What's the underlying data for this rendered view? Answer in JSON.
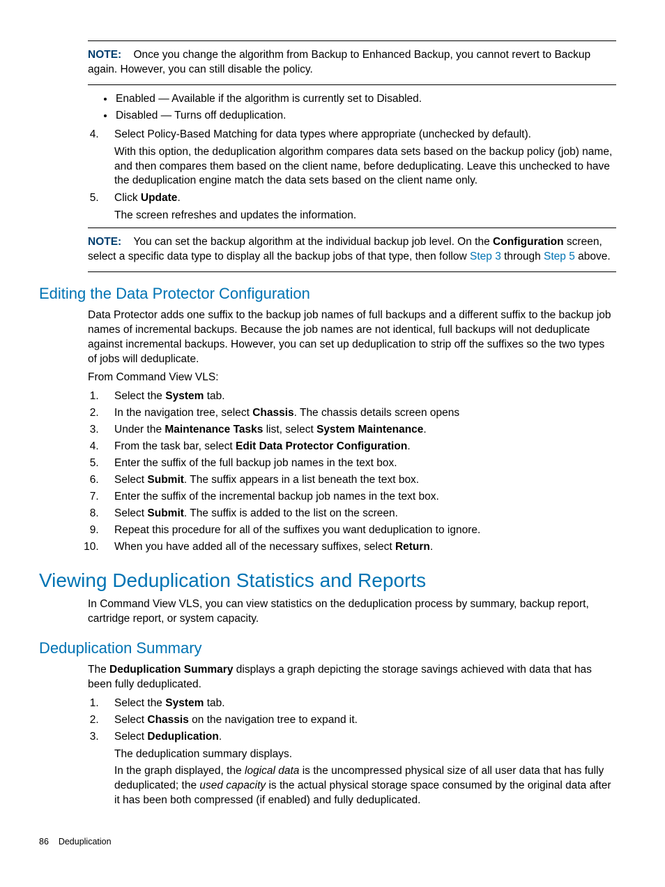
{
  "note1": {
    "label": "NOTE:",
    "text": "Once you change the algorithm from Backup to Enhanced Backup, you cannot revert to Backup again. However, you can still disable the policy."
  },
  "bullets": [
    "Enabled — Available if the algorithm is currently set to Disabled.",
    "Disabled — Turns off deduplication."
  ],
  "step4": {
    "lead": "Select Policy-Based Matching for data types where appropriate (unchecked by default).",
    "body": "With this option, the deduplication algorithm compares data sets based on the backup policy (job) name, and then compares them based on the client name, before deduplicating. Leave this unchecked to have the deduplication engine match the data sets based on the client name only."
  },
  "step5": {
    "lead_pre": "Click ",
    "lead_bold": "Update",
    "lead_post": ".",
    "body": "The screen refreshes and updates the information."
  },
  "note2": {
    "label": "NOTE:",
    "t1": "You can set the backup algorithm at the individual backup job level. On the ",
    "b1": "Configuration",
    "t2": " screen, select a specific data type to display all the backup jobs of that type, then follow ",
    "l1": "Step 3",
    "t3": " through ",
    "l2": "Step 5",
    "t4": " above."
  },
  "editing": {
    "title": "Editing the Data Protector Configuration",
    "p1": "Data Protector adds one suffix to the backup job names of full backups and a different suffix to the backup job names of incremental backups. Because the job names are not identical, full backups will not deduplicate against incremental backups. However, you can set up deduplication to strip off the suffixes so the two types of jobs will deduplicate.",
    "p2": "From Command View VLS:"
  },
  "editing_steps": {
    "s1a": "Select the ",
    "s1b": "System",
    "s1c": " tab.",
    "s2a": "In the navigation tree, select ",
    "s2b": "Chassis",
    "s2c": ". The chassis details screen opens",
    "s3a": "Under the ",
    "s3b": "Maintenance Tasks",
    "s3c": " list, select ",
    "s3d": "System Maintenance",
    "s3e": ".",
    "s4a": "From the task bar, select ",
    "s4b": "Edit Data Protector Configuration",
    "s4c": ".",
    "s5": "Enter the suffix of the full backup job names in the text box.",
    "s6a": "Select ",
    "s6b": "Submit",
    "s6c": ". The suffix appears in a list beneath the text box.",
    "s7": "Enter the suffix of the incremental backup job names in the text box.",
    "s8a": "Select ",
    "s8b": "Submit",
    "s8c": ". The suffix is added to the list on the screen.",
    "s9": "Repeat this procedure for all of the suffixes you want deduplication to ignore.",
    "s10a": "When you have added all of the necessary suffixes, select ",
    "s10b": "Return",
    "s10c": "."
  },
  "viewing": {
    "title": "Viewing Deduplication Statistics and Reports",
    "p1": "In Command View VLS, you can view statistics on the deduplication process by summary, backup report, cartridge report, or system capacity."
  },
  "dedup": {
    "title": "Deduplication Summary",
    "p1a": "The ",
    "p1b": "Deduplication Summary",
    "p1c": " displays a graph depicting the storage savings achieved with data that has been fully deduplicated."
  },
  "dedup_steps": {
    "s1a": "Select the ",
    "s1b": "System",
    "s1c": " tab.",
    "s2a": "Select ",
    "s2b": "Chassis",
    "s2c": " on the navigation tree to expand it.",
    "s3a": "Select ",
    "s3b": "Deduplication",
    "s3c": ".",
    "s3p1": "The deduplication summary displays.",
    "s3p2a": "In the graph displayed, the ",
    "s3p2i1": "logical data",
    "s3p2b": " is the uncompressed physical size of all user data that has fully deduplicated; the ",
    "s3p2i2": "used capacity",
    "s3p2c": " is the actual physical storage space consumed by the original data after it has been both compressed (if enabled) and fully deduplicated."
  },
  "footer": {
    "num": "86",
    "section": "Deduplication"
  }
}
